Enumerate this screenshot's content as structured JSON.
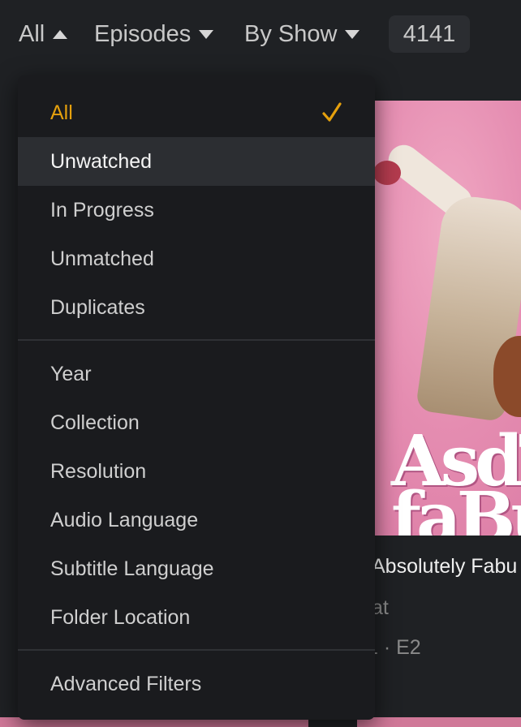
{
  "toolbar": {
    "filter_label": "All",
    "type_label": "Episodes",
    "group_label": "By Show",
    "count": "4141"
  },
  "tile": {
    "poster_text": "AsdTI faBu",
    "title": "Absolutely Fabu",
    "subtitle": "at",
    "episode": "1 · E2"
  },
  "menu": {
    "selected_color": "#e5a00d",
    "items": [
      {
        "label": "All",
        "selected": true
      },
      {
        "label": "Unwatched",
        "hover": true
      },
      {
        "label": "In Progress"
      },
      {
        "label": "Unmatched"
      },
      {
        "label": "Duplicates"
      },
      {
        "label": "Year"
      },
      {
        "label": "Collection"
      },
      {
        "label": "Resolution"
      },
      {
        "label": "Audio Language"
      },
      {
        "label": "Subtitle Language"
      },
      {
        "label": "Folder Location"
      },
      {
        "label": "Advanced Filters"
      }
    ]
  },
  "icons": {
    "checkmark": "check-icon",
    "caret_up": "caret-up-icon",
    "caret_down": "caret-down-icon"
  }
}
